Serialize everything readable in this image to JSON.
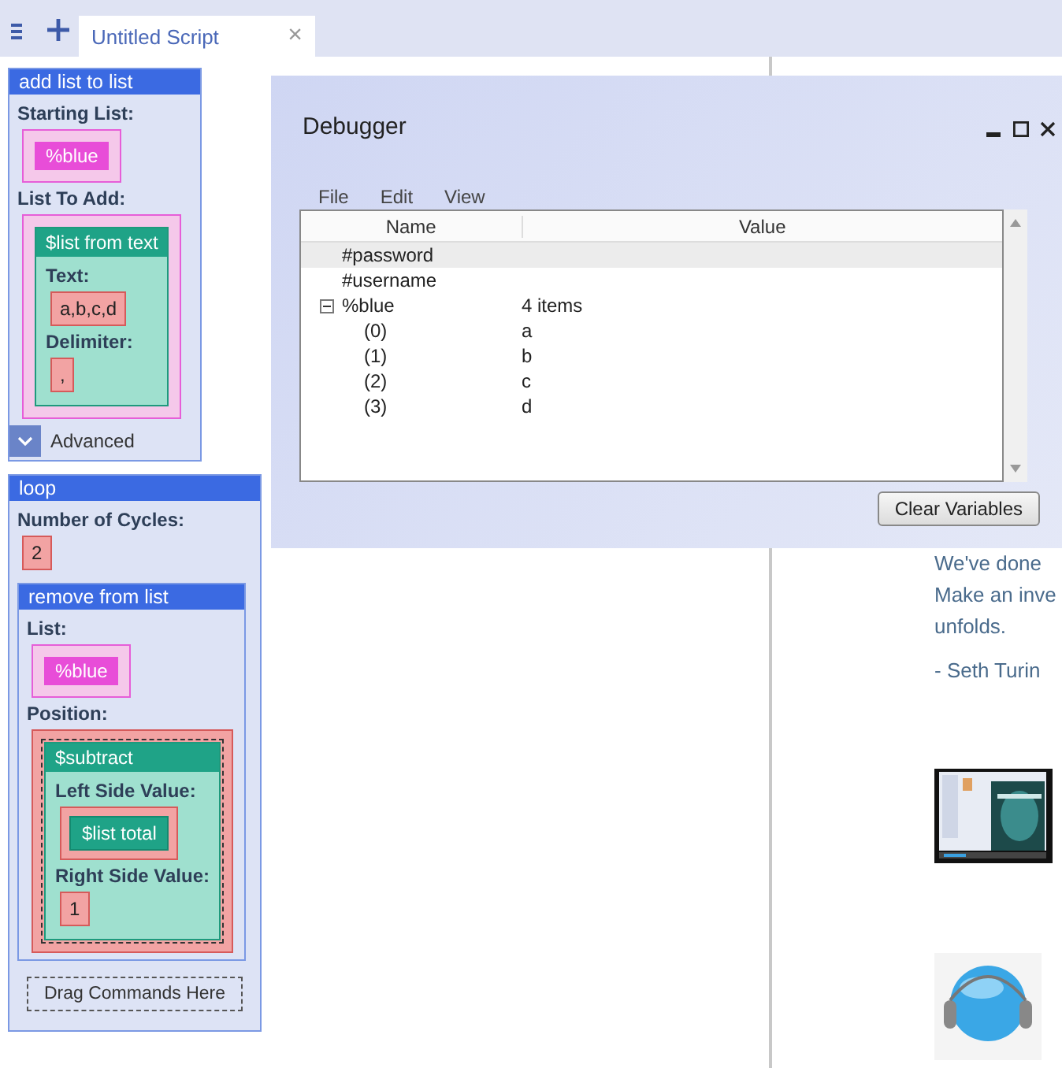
{
  "tabs": [
    {
      "label": "Untitled Script",
      "selected": true,
      "close": "×"
    }
  ],
  "script": [
    {
      "title": "add list to list",
      "params": [
        {
          "label": "Starting List:",
          "value": {
            "kind": "variable",
            "text": "%blue"
          }
        },
        {
          "label": "List To Add:",
          "kind": "list",
          "value": {
            "kind": "function",
            "title": "$list from text",
            "params": [
              {
                "label": "Text:",
                "value": {
                  "kind": "literal",
                  "text": "a,b,c,d"
                }
              },
              {
                "label": "Delimiter:",
                "value": {
                  "kind": "literal",
                  "text": ","
                }
              }
            ]
          }
        }
      ],
      "advanced": {
        "label": "Advanced",
        "expanded": false
      }
    },
    {
      "title": "loop",
      "params": [
        {
          "label": "Number of Cycles:",
          "value": {
            "kind": "literal",
            "text": "2"
          }
        }
      ],
      "body": [
        {
          "title": "remove from list",
          "params": [
            {
              "label": "List:",
              "value": {
                "kind": "variable",
                "text": "%blue"
              }
            },
            {
              "label": "Position:",
              "kind": "number",
              "value": {
                "kind": "function",
                "title": "$subtract",
                "params": [
                  {
                    "label": "Left Side Value:",
                    "kind": "number",
                    "value": {
                      "kind": "function",
                      "title": "$list total"
                    }
                  },
                  {
                    "label": "Right Side Value:",
                    "value": {
                      "kind": "literal",
                      "text": "1"
                    }
                  }
                ]
              }
            }
          ]
        }
      ],
      "drop_hint": "Drag Commands Here"
    }
  ],
  "article": {
    "lines": [
      "We've done",
      "Make an inve",
      "unfolds."
    ],
    "signature": "- Seth Turin",
    "video": {
      "kind": "picture"
    }
  },
  "debugger": {
    "title": "Debugger",
    "menu": [
      "File",
      "Edit",
      "View"
    ],
    "columns": [
      "Name",
      "Value"
    ],
    "rows": [
      {
        "name": "#password",
        "selected": true
      },
      {
        "name": "#username",
        "selected": false
      },
      {
        "name": "%blue",
        "value": "4 items",
        "selected": false,
        "expanded": true,
        "children": [
          {
            "name": "(0)",
            "value": "a",
            "selected": false
          },
          {
            "name": "(1)",
            "value": "b",
            "selected": false
          },
          {
            "name": "(2)",
            "value": "c",
            "selected": false
          },
          {
            "name": "(3)",
            "value": "d",
            "selected": false
          }
        ]
      }
    ],
    "button": "Clear Variables"
  }
}
